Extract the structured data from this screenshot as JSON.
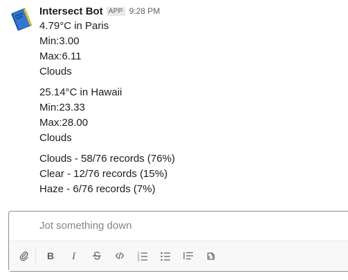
{
  "message": {
    "sender": "Intersect Bot",
    "badge": "APP",
    "time": "9:28 PM",
    "blocks": [
      [
        "4.79°C in Paris",
        "Min:3.00",
        "Max:6.11",
        "Clouds"
      ],
      [
        "25.14°C in Hawaii",
        "Min:23.33",
        "Max:28.00",
        "Clouds"
      ],
      [
        "Clouds - 58/76 records (76%)",
        "Clear - 12/76 records (15%)",
        "Haze - 6/76 records (7%)"
      ]
    ]
  },
  "composer": {
    "placeholder": "Jot something down",
    "toolbar_icons": [
      "paperclip-icon",
      "bold-icon",
      "italic-icon",
      "strikethrough-icon",
      "code-icon",
      "ordered-list-icon",
      "bulleted-list-icon",
      "blockquote-icon",
      "code-block-icon"
    ]
  },
  "colors": {
    "text": "#1d1c1d",
    "muted": "#616061",
    "placeholder": "#868686",
    "border": "#8d8d8d",
    "toolbar_bg": "#f8f8f8"
  }
}
